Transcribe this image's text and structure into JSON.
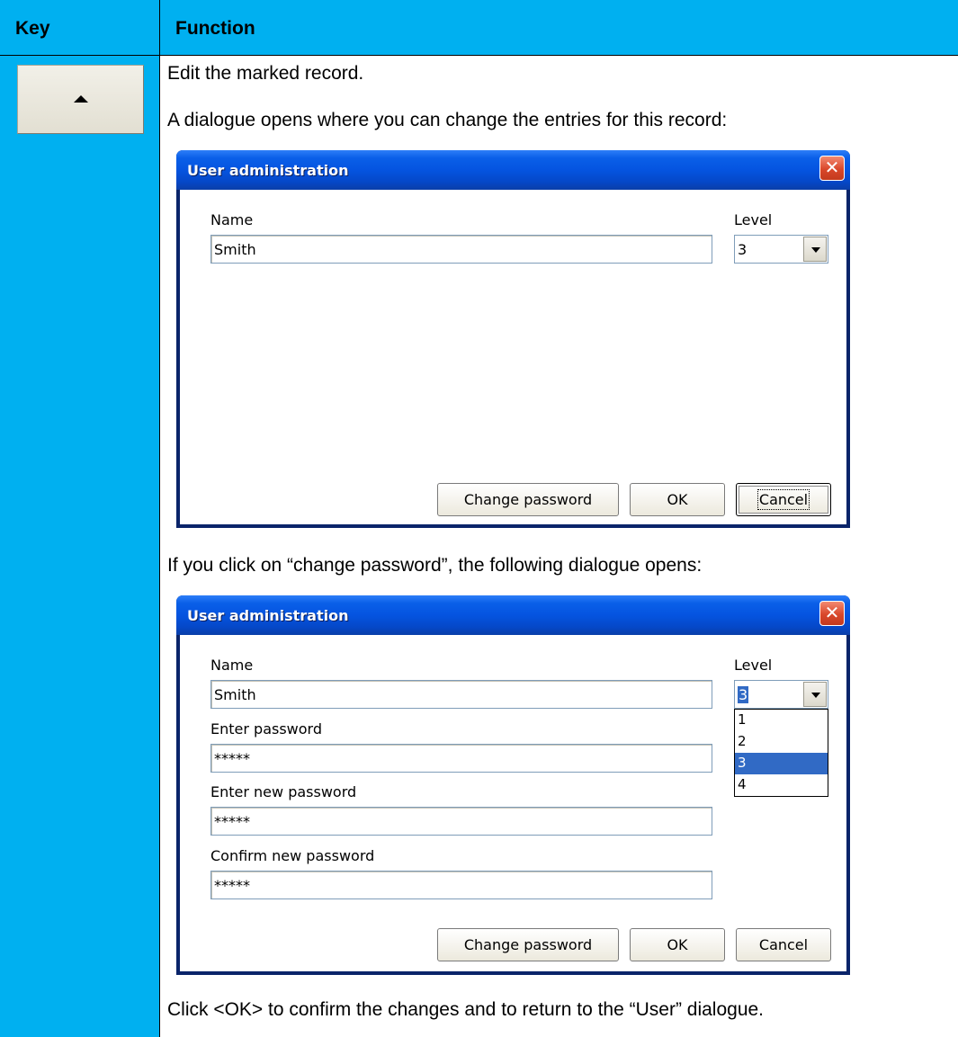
{
  "table": {
    "header_key": "Key",
    "header_function": "Function"
  },
  "key_button": {
    "icon": "arrow-up-icon"
  },
  "text": {
    "line1": "Edit the marked record.",
    "line2": "A dialogue opens where you can change the entries for this record:",
    "line3": "If you click on “change password”, the following dialogue opens:",
    "line4": "Click <OK> to confirm the changes and to return to the “User” dialogue."
  },
  "dialog1": {
    "title": "User administration",
    "close": "✕",
    "name_label": "Name",
    "name_value": "Smith",
    "level_label": "Level",
    "level_value": "3",
    "buttons": {
      "change_password": "Change password",
      "ok": "OK",
      "cancel": "Cancel"
    }
  },
  "dialog2": {
    "title": "User administration",
    "close": "✕",
    "name_label": "Name",
    "name_value": "Smith",
    "level_label": "Level",
    "level_value": "3",
    "level_options": [
      "1",
      "2",
      "3",
      "4"
    ],
    "enter_password_label": "Enter password",
    "enter_password_value": "*****",
    "new_password_label": "Enter new password",
    "new_password_value": "*****",
    "confirm_password_label": "Confirm new password",
    "confirm_password_value": "*****",
    "buttons": {
      "change_password": "Change password",
      "ok": "OK",
      "cancel": "Cancel"
    }
  }
}
